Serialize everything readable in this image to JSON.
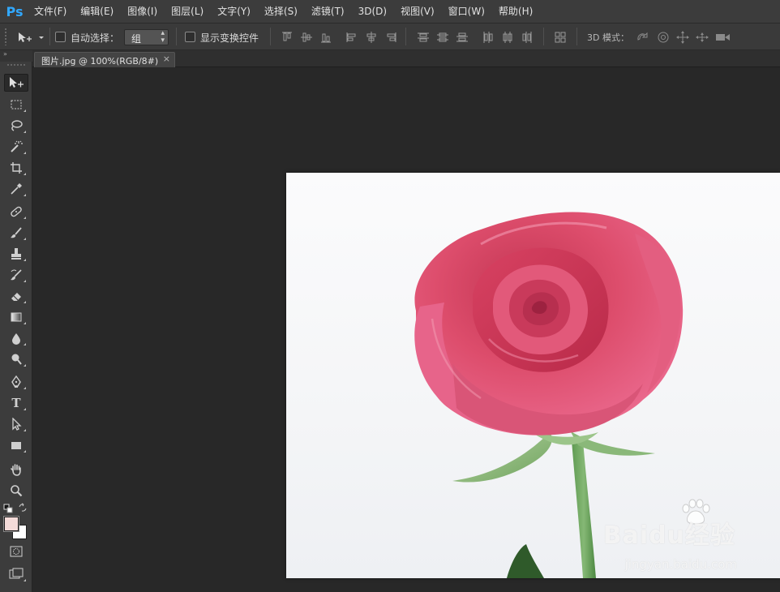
{
  "app": {
    "logo": "Ps",
    "menu": [
      "文件(F)",
      "编辑(E)",
      "图像(I)",
      "图层(L)",
      "文字(Y)",
      "选择(S)",
      "滤镜(T)",
      "3D(D)",
      "视图(V)",
      "窗口(W)",
      "帮助(H)"
    ]
  },
  "options_bar": {
    "auto_select_label": "自动选择：",
    "auto_select_value": "组",
    "show_transform_label": "显示变换控件",
    "mode_3d_label": "3D 模式："
  },
  "document": {
    "tab_title": "图片.jpg @ 100%(RGB/8#)",
    "close_glyph": "×",
    "watermark_brand": "Baidu经验",
    "watermark_url": "jingyan.baidu.com"
  },
  "tools": {
    "type_glyph": "T",
    "collapse_glyph": "»",
    "foreground_color": "#f4dbd9",
    "background_color": "#ffffff"
  },
  "colors": {
    "menubar": "#3c3c3c",
    "panel": "#3c3c3c",
    "canvas_bg": "#282828",
    "ps_blue": "#31a8ff",
    "rose": "#e0506e"
  }
}
